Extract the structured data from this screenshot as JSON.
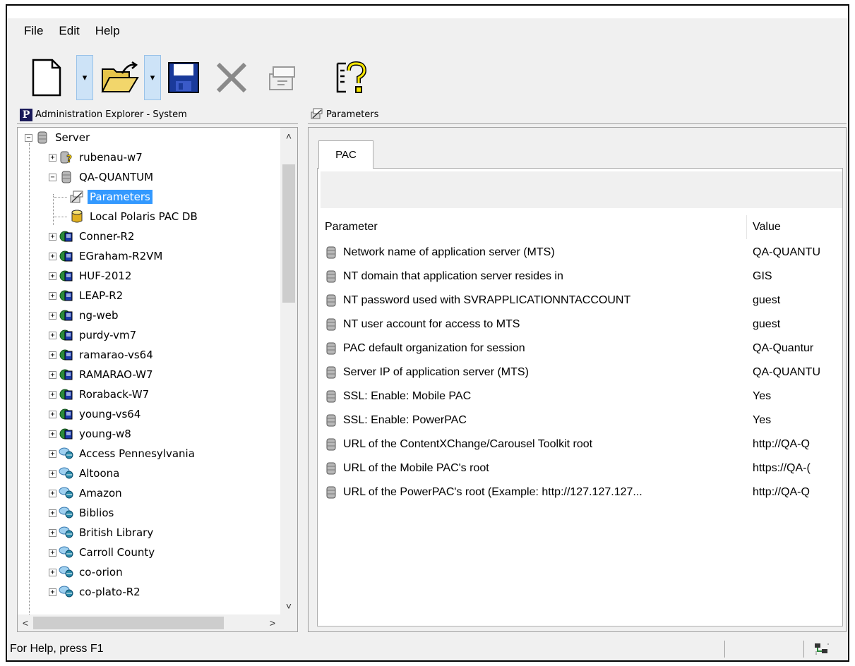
{
  "menu": {
    "file": "File",
    "edit": "Edit",
    "help": "Help"
  },
  "toolbar": {
    "buttons": [
      {
        "name": "new-icon",
        "enabled": true
      },
      {
        "name": "open-icon",
        "enabled": true
      },
      {
        "name": "save-icon",
        "enabled": true
      },
      {
        "name": "delete-icon",
        "enabled": false
      },
      {
        "name": "properties-icon",
        "enabled": false
      },
      {
        "name": "context-help-icon",
        "enabled": true
      }
    ],
    "dropdown_glyph": "▾"
  },
  "left_pane": {
    "title": "Administration Explorer - System",
    "title_icon_letter": "P"
  },
  "tree": {
    "root": "Server",
    "nodes": {
      "rubenau": "rubenau-w7",
      "qa_quantum": "QA-QUANTUM",
      "parameters": "Parameters",
      "local_db": "Local Polaris PAC DB",
      "servers": [
        "Conner-R2",
        "EGraham-R2VM",
        "HUF-2012",
        "LEAP-R2",
        "ng-web",
        "purdy-vm7",
        "ramarao-vs64",
        "RAMARAO-W7",
        "Roraback-W7",
        "young-vs64",
        "young-w8"
      ],
      "remotes": [
        "Access Pennesylvania",
        "Altoona",
        "Amazon",
        "Biblios",
        "British Library",
        "Carroll County",
        "co-orion",
        "co-plato-R2"
      ]
    },
    "expand_glyph": "+",
    "collapse_glyph": "−"
  },
  "scroll": {
    "up": "˄",
    "down": "˅",
    "left": "<",
    "right": ">"
  },
  "right_pane": {
    "title": "Parameters",
    "tab_label": "PAC",
    "columns": {
      "parameter": "Parameter",
      "value": "Value"
    },
    "rows": [
      {
        "parameter": "Network name of application server (MTS)",
        "value": "QA-QUANTU"
      },
      {
        "parameter": "NT domain that application server resides in",
        "value": "GIS"
      },
      {
        "parameter": "NT password used with SVRAPPLICATIONNTACCOUNT",
        "value": "guest"
      },
      {
        "parameter": "NT user account for access to MTS",
        "value": "guest"
      },
      {
        "parameter": "PAC default organization for session",
        "value": "QA-Quantur"
      },
      {
        "parameter": "Server IP of application server (MTS)",
        "value": "QA-QUANTU"
      },
      {
        "parameter": "SSL: Enable: Mobile PAC",
        "value": "Yes"
      },
      {
        "parameter": "SSL: Enable: PowerPAC",
        "value": "Yes"
      },
      {
        "parameter": "URL of the ContentXChange/Carousel Toolkit root",
        "value": "http://QA-Q"
      },
      {
        "parameter": "URL of the Mobile PAC's root",
        "value": "https://QA-("
      },
      {
        "parameter": "URL of the PowerPAC's root (Example: http://127.127.127...",
        "value": "http://QA-Q"
      }
    ]
  },
  "status": {
    "text": "For Help, press F1"
  },
  "colors": {
    "selection": "#3399ff",
    "window_bg": "#f0f0f0",
    "toolbar_dropdown": "#cde3f7"
  }
}
